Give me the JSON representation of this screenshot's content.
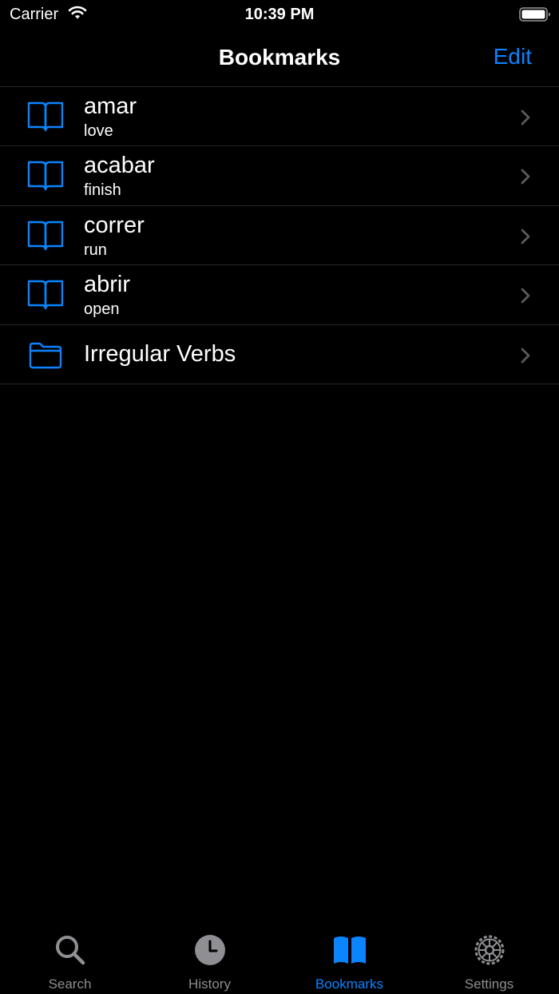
{
  "status_bar": {
    "carrier": "Carrier",
    "time": "10:39 PM"
  },
  "nav": {
    "title": "Bookmarks",
    "edit_label": "Edit"
  },
  "bookmarks": [
    {
      "title": "amar",
      "subtitle": "love",
      "icon": "book-icon"
    },
    {
      "title": "acabar",
      "subtitle": "finish",
      "icon": "book-icon"
    },
    {
      "title": "correr",
      "subtitle": "run",
      "icon": "book-icon"
    },
    {
      "title": "abrir",
      "subtitle": "open",
      "icon": "book-icon"
    },
    {
      "title": "Irregular Verbs",
      "subtitle": "",
      "icon": "folder-icon"
    }
  ],
  "tabs": [
    {
      "label": "Search",
      "icon": "search-icon",
      "active": false
    },
    {
      "label": "History",
      "icon": "clock-icon",
      "active": false
    },
    {
      "label": "Bookmarks",
      "icon": "book-icon",
      "active": true
    },
    {
      "label": "Settings",
      "icon": "gear-icon",
      "active": false
    }
  ],
  "colors": {
    "accent": "#0a84ff",
    "background": "#000000",
    "inactive": "#8e8e93",
    "separator": "#262628"
  }
}
